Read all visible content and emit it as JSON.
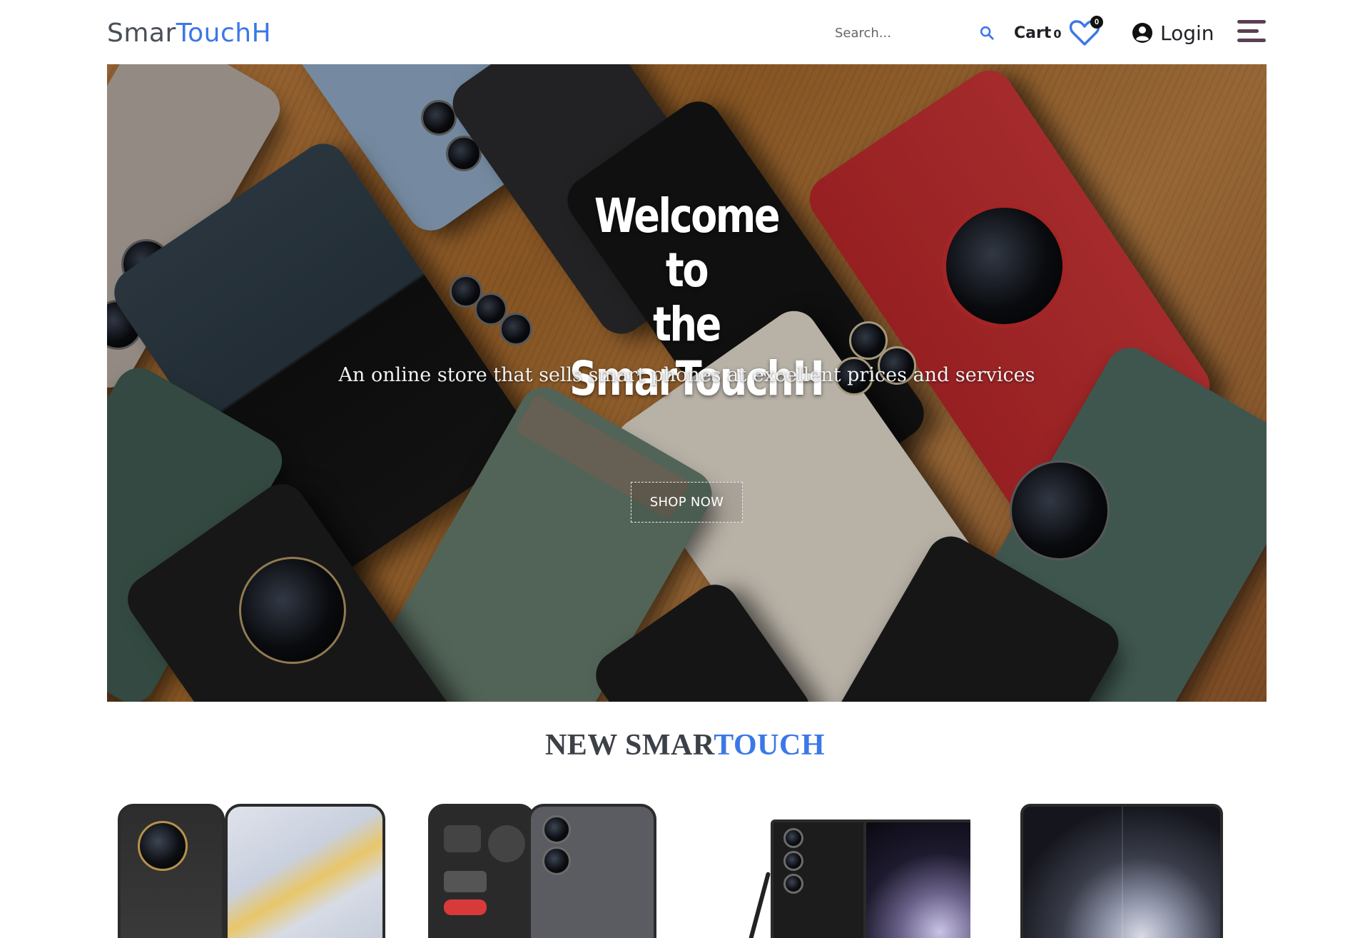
{
  "header": {
    "logo": {
      "part1": "Smar",
      "part2": "TouchH"
    },
    "search": {
      "placeholder": "Search...",
      "icon": "search-icon"
    },
    "cart": {
      "label": "Cart",
      "count": "0"
    },
    "wishlist": {
      "icon": "heart-icon",
      "count": "0"
    },
    "login": {
      "icon": "user-circle-icon",
      "label": "Login"
    },
    "menu": {
      "icon": "hamburger-menu-icon"
    }
  },
  "hero": {
    "title_line1": "Welcome to",
    "title_line2": "the",
    "title_line3": "SmarTouchH",
    "subtitle": "An online store that sells smart phones at excellent prices and services",
    "cta_label": "SHOP NOW"
  },
  "new_section": {
    "title_part1": "NEW SMAR",
    "title_part2": "TOUCH"
  },
  "colors": {
    "brand_blue": "#3b78e7",
    "logo_gray": "#4a4f57",
    "menu_purple": "#5b3f52",
    "heart_blue": "#3b78e7"
  }
}
